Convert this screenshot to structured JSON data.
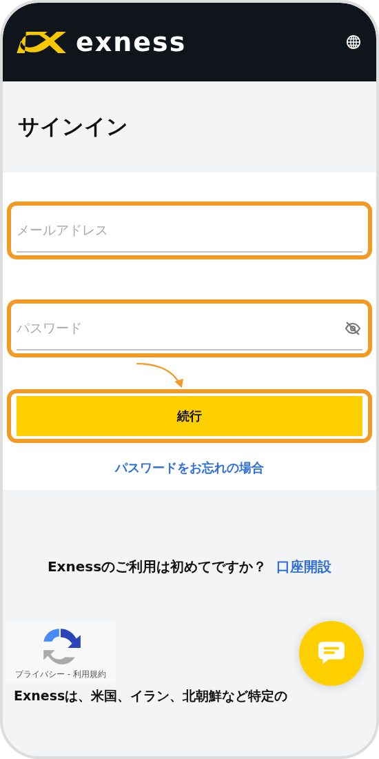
{
  "header": {
    "brand": "exness"
  },
  "title": "サインイン",
  "fields": [
    {
      "kind": "email",
      "placeholder": "メールアドレス",
      "highlighted": true
    },
    {
      "kind": "password",
      "placeholder": "パスワード",
      "highlighted": true
    }
  ],
  "continue_button": {
    "label": "続行",
    "highlighted": true
  },
  "forgot_link": "パスワードをお忘れの場合",
  "signup": {
    "question": "Exnessのご利用は初めてですか？",
    "link": "口座開設"
  },
  "recaptcha": {
    "links": "プライバシー - 利用規約"
  },
  "disclaimer": "Exnessは、米国、イラン、北朝鮮など特定の"
}
